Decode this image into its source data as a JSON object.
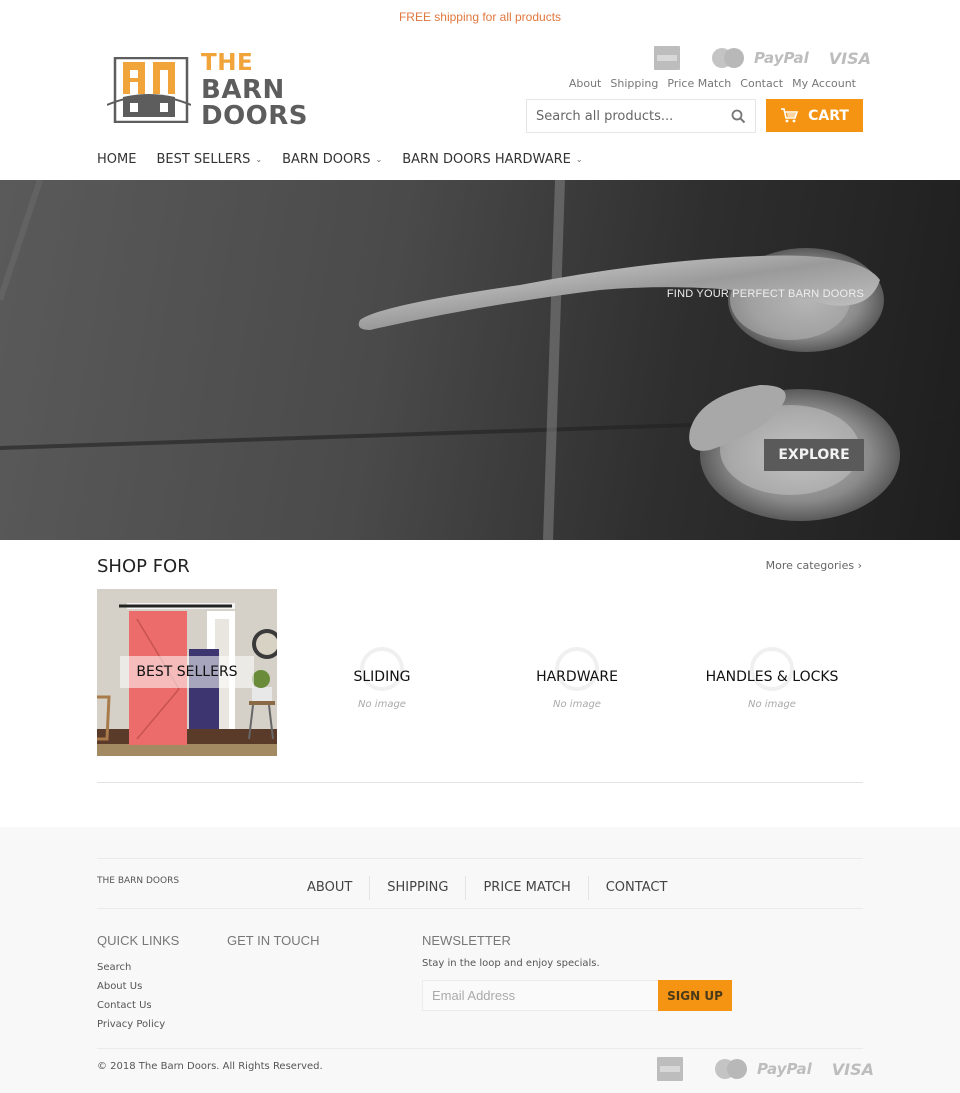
{
  "announcement": "FREE shipping for all products",
  "brand": {
    "logo_line1": "THE",
    "logo_line2": "BARN DOORS",
    "colors": {
      "accent": "#f59413",
      "logo_orange": "#f0a43a",
      "logo_gray": "#5d5d5d",
      "announce": "#e0773d"
    }
  },
  "payments": {
    "icons": [
      "amex-icon",
      "mastercard-icon",
      "paypal-icon",
      "visa-icon"
    ],
    "paypal_label": "PayPal",
    "visa_label": "VISA"
  },
  "top_links": [
    {
      "label": "About"
    },
    {
      "label": "Shipping"
    },
    {
      "label": "Price Match"
    },
    {
      "label": "Contact"
    },
    {
      "label": "My Account"
    }
  ],
  "search": {
    "placeholder": "Search all products...",
    "value": ""
  },
  "cart": {
    "label": "CART"
  },
  "nav": [
    {
      "label": "HOME",
      "dropdown": false
    },
    {
      "label": "BEST SELLERS",
      "dropdown": true
    },
    {
      "label": "BARN DOORS",
      "dropdown": true
    },
    {
      "label": "BARN DOORS HARDWARE",
      "dropdown": true
    }
  ],
  "hero": {
    "tagline": "FIND YOUR PERFECT BARN DOORS",
    "button_label": "EXPLORE"
  },
  "shop": {
    "title": "SHOP FOR",
    "more_link": "More categories ›",
    "categories": [
      {
        "label": "BEST SELLERS",
        "has_image": true
      },
      {
        "label": "SLIDING",
        "has_image": false,
        "placeholder": "No image"
      },
      {
        "label": "HARDWARE",
        "has_image": false,
        "placeholder": "No image"
      },
      {
        "label": "HANDLES & LOCKS",
        "has_image": false,
        "placeholder": "No image"
      }
    ]
  },
  "footer": {
    "brand": "THE BARN DOORS",
    "links": [
      {
        "label": "ABOUT"
      },
      {
        "label": "SHIPPING"
      },
      {
        "label": "PRICE MATCH"
      },
      {
        "label": "CONTACT"
      }
    ],
    "quick_links_title": "QUICK LINKS",
    "quick_links": [
      {
        "label": "Search"
      },
      {
        "label": "About Us"
      },
      {
        "label": "Contact Us"
      },
      {
        "label": "Privacy Policy"
      }
    ],
    "get_in_touch_title": "GET IN TOUCH",
    "newsletter_title": "NEWSLETTER",
    "newsletter_text": "Stay in the loop and enjoy specials.",
    "email_placeholder": "Email Address",
    "signup_label": "SIGN UP",
    "copyright": "© 2018 The Barn Doors. All Rights Reserved."
  }
}
